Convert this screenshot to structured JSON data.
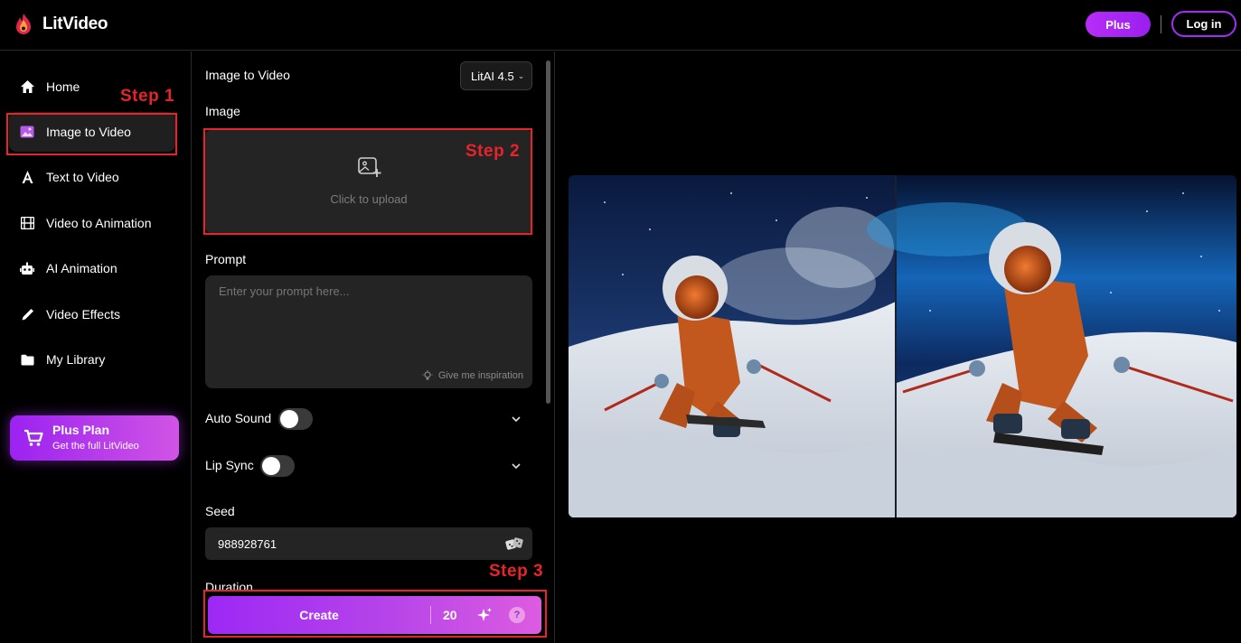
{
  "app": {
    "name": "LitVideo"
  },
  "header": {
    "plus_label": "Plus",
    "login_label": "Log in"
  },
  "sidebar": {
    "items": [
      {
        "label": "Home",
        "icon": "home-icon"
      },
      {
        "label": "Image to Video",
        "icon": "image-icon",
        "active": true
      },
      {
        "label": "Text to Video",
        "icon": "text-icon"
      },
      {
        "label": "Video to Animation",
        "icon": "film-icon"
      },
      {
        "label": "AI Animation",
        "icon": "robot-icon"
      },
      {
        "label": "Video Effects",
        "icon": "pen-icon"
      },
      {
        "label": "My Library",
        "icon": "folder-icon"
      }
    ],
    "plus_card": {
      "title": "Plus Plan",
      "subtitle": "Get the full LitVideo"
    }
  },
  "panel": {
    "title": "Image to Video",
    "model": "LitAI 4.5",
    "image_label": "Image",
    "upload_text": "Click to upload",
    "prompt_label": "Prompt",
    "prompt_placeholder": "Enter your prompt here...",
    "inspiration_label": "Give me inspiration",
    "auto_sound_label": "Auto Sound",
    "auto_sound_on": false,
    "lip_sync_label": "Lip Sync",
    "lip_sync_on": false,
    "seed_label": "Seed",
    "seed_value": "988928761",
    "duration_label": "Duration"
  },
  "create": {
    "label": "Create",
    "credits": "20",
    "help": "?"
  },
  "annotations": {
    "step1": "Step 1",
    "step2": "Step 2",
    "step3": "Step 3"
  },
  "colors": {
    "accent": "#a52cf2",
    "annotation": "#e8232a"
  }
}
